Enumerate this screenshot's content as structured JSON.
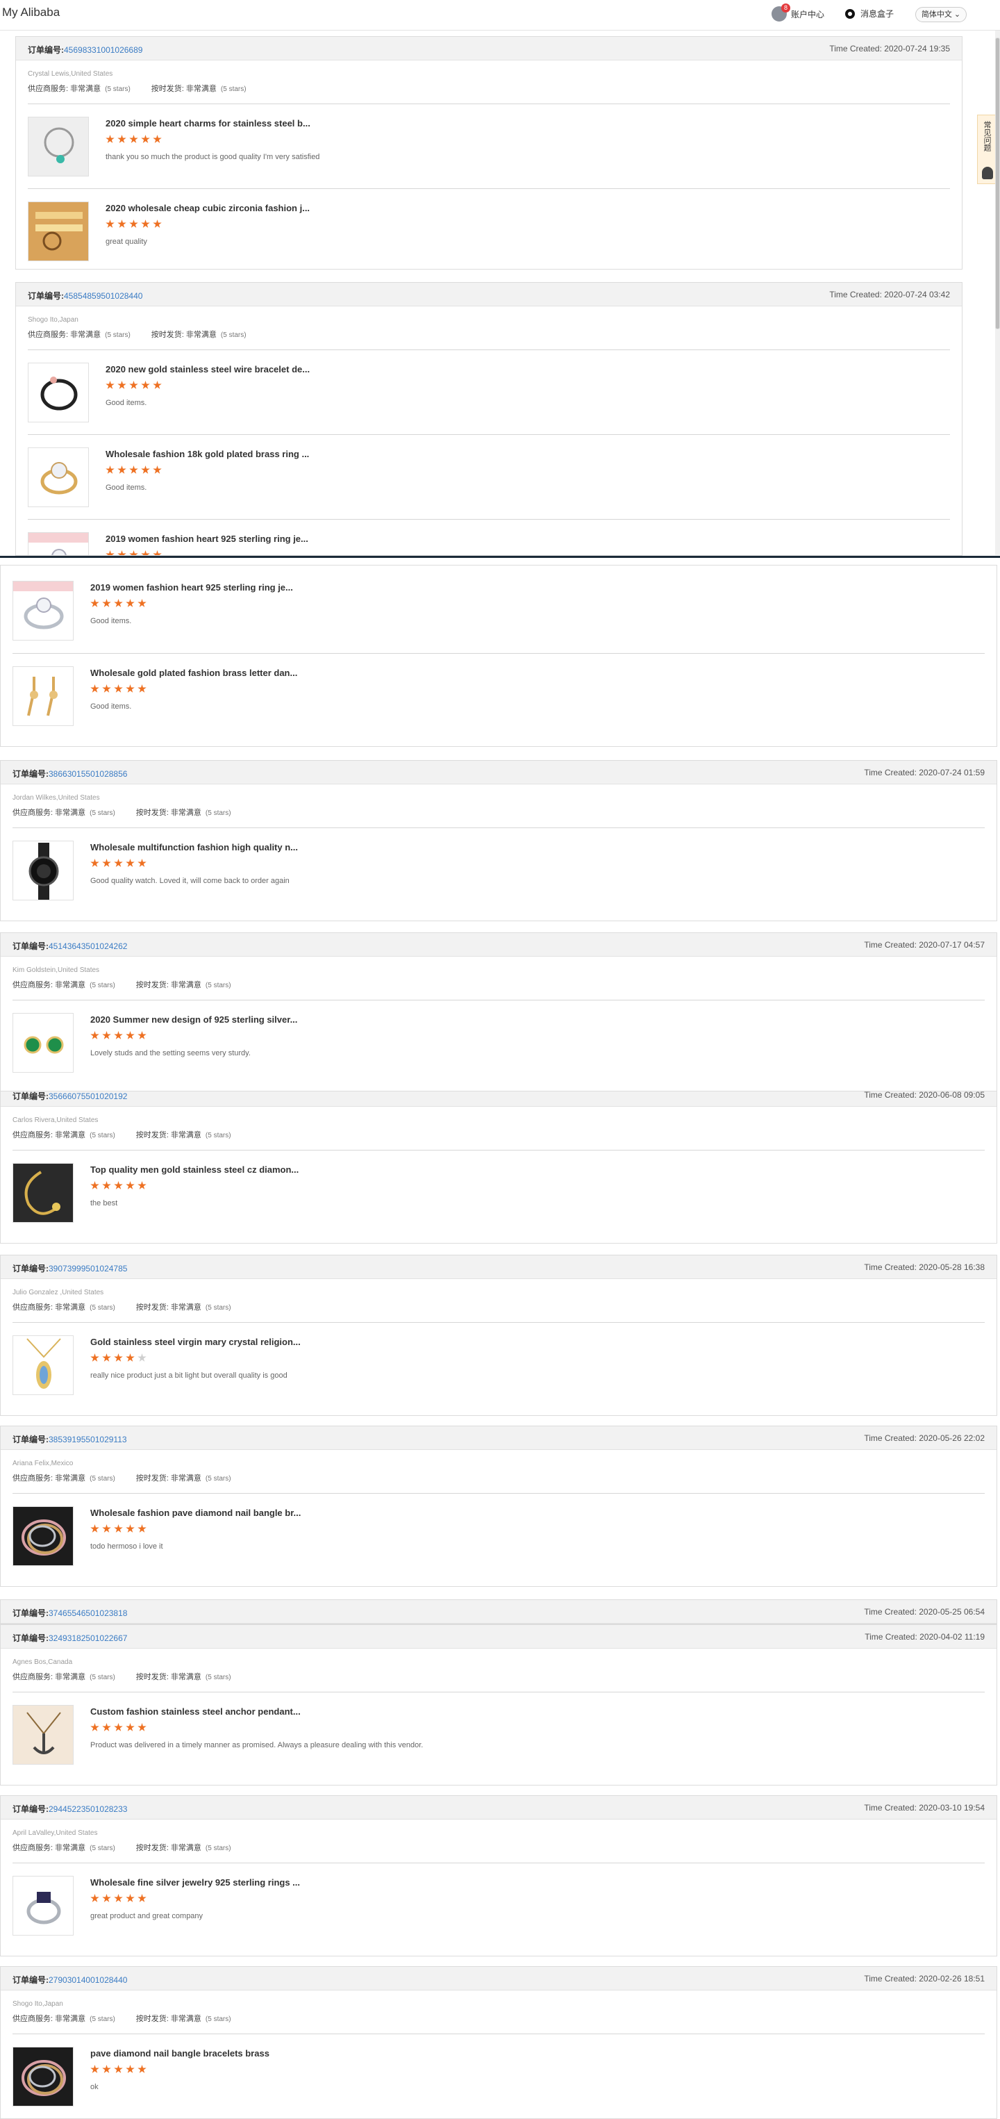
{
  "header": {
    "brand": "My Alibaba",
    "account_badge": "8",
    "account_label": "账户中心",
    "message_label": "消息盒子",
    "language": "简体中文 ⌄"
  },
  "faq_label": "常见问题",
  "labels": {
    "order_no": "订单编号:",
    "time_created": "Time Created:",
    "supplier_service": "供应商服务:",
    "on_time_shipping": "按时发货:",
    "rating_value": "非常满意",
    "rating_stars": "(5 stars)"
  },
  "colors": {
    "accent": "#ee7123",
    "link": "#3b7cc4",
    "header_bg": "#f2f2f2"
  },
  "cards": [
    {
      "order_id": "4569833100 1026689",
      "time": "2020-07-24 19:35",
      "buyer": "Crystal Lewis,United States",
      "ratings": true,
      "items": [
        {
          "title": "2020 simple heart charms for stainless steel b...",
          "stars": 5,
          "review": "thank you so much the product is good quality I'm very satisfied",
          "img": "bracelet"
        },
        {
          "title": "2020 wholesale cheap cubic zirconia fashion j...",
          "stars": 5,
          "review": "great quality",
          "img": "gold"
        }
      ]
    },
    {
      "order_id": "45854859501028440",
      "time": "2020-07-24 03:42",
      "buyer": "Shogo Ito,Japan",
      "ratings": true,
      "items": [
        {
          "title": "2020 new gold stainless steel wire bracelet de...",
          "stars": 5,
          "review": "Good items.",
          "img": "wire"
        },
        {
          "title": "Wholesale fashion 18k gold plated brass ring ...",
          "stars": 5,
          "review": "Good items.",
          "img": "ring"
        },
        {
          "title": "2019 women fashion heart 925 sterling ring je...",
          "stars": 5,
          "review": "",
          "img": "silverring"
        }
      ]
    },
    {
      "order_id": "",
      "time": "",
      "buyer": "",
      "ratings": false,
      "items": [
        {
          "title": "2019 women fashion heart 925 sterling ring je...",
          "stars": 5,
          "review": "Good items.",
          "img": "silverring"
        },
        {
          "title": "Wholesale gold plated fashion brass letter dan...",
          "stars": 5,
          "review": "Good items.",
          "img": "earring"
        }
      ]
    },
    {
      "order_id": "38663015501028856",
      "time": "2020-07-24 01:59",
      "buyer": "Jordan Wilkes,United States",
      "ratings": true,
      "items": [
        {
          "title": "Wholesale multifunction fashion high quality n...",
          "stars": 5,
          "review": "Good quality watch. Loved it, will come back to order again",
          "img": "watch"
        }
      ]
    },
    {
      "order_id": "45143643501024262",
      "time": "2020-07-17 04:57",
      "buyer": "Kim Goldstein,United States",
      "ratings": true,
      "items": [
        {
          "title": "2020 Summer new design of 925 sterling silver...",
          "stars": 5,
          "review": "Lovely studs and the setting seems very sturdy.",
          "img": "studs"
        }
      ]
    },
    {
      "order_id": "35666075501020192",
      "time": "2020-06-08 09:05",
      "buyer": "Carlos Rivera,United States",
      "ratings": true,
      "items": [
        {
          "title": "Top quality men gold stainless steel cz diamon...",
          "stars": 5,
          "review": "the best",
          "img": "chain"
        }
      ]
    },
    {
      "order_id": "39073999501024785",
      "time": "2020-05-28 16:38",
      "buyer": "Julio Gonzalez ,United States",
      "ratings": true,
      "items": [
        {
          "title": "Gold stainless steel virgin mary crystal religion...",
          "stars": 4,
          "review": "really nice product just a bit light but overall quality is good",
          "img": "pendant"
        }
      ]
    },
    {
      "order_id": "38539195501029113",
      "time": "2020-05-26 22:02",
      "buyer": "Ariana Felix,Mexico",
      "ratings": true,
      "items": [
        {
          "title": "Wholesale fashion pave diamond nail bangle br...",
          "stars": 5,
          "review": "todo hermoso i love it",
          "img": "bangle"
        }
      ]
    },
    {
      "order_id": "37465546501023818",
      "time": "2020-05-25 06:54",
      "buyer": "",
      "ratings": false,
      "items": []
    },
    {
      "order_id": "32493182501022667",
      "time": "2020-04-02 11:19",
      "buyer": "Agnes Bos,Canada",
      "ratings": true,
      "items": [
        {
          "title": "Custom fashion stainless steel anchor pendant...",
          "stars": 5,
          "review": "Product was delivered in a timely manner as promised. Always a pleasure dealing with this vendor.",
          "img": "anchor"
        }
      ]
    },
    {
      "order_id": "29445223501028233",
      "time": "2020-03-10 19:54",
      "buyer": "April LaValley,United States",
      "ratings": true,
      "items": [
        {
          "title": "Wholesale fine silver jewelry 925 sterling rings ...",
          "stars": 5,
          "review": "great product and great company",
          "img": "silverring2"
        }
      ]
    },
    {
      "order_id": "27903014001028440",
      "time": "2020-02-26 18:51",
      "buyer": "Shogo Ito,Japan",
      "ratings": true,
      "items": [
        {
          "title": "pave diamond nail bangle bracelets brass",
          "stars": 5,
          "review": "ok",
          "img": "bangle"
        }
      ]
    }
  ]
}
